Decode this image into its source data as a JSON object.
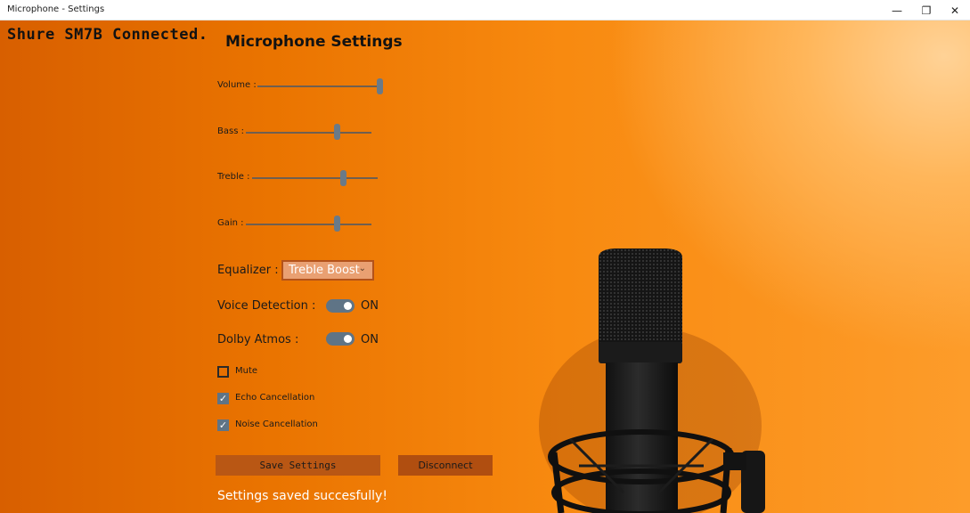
{
  "window": {
    "title": "Microphone - Settings",
    "minimize_icon": "—",
    "restore_icon": "❐",
    "close_icon": "✕"
  },
  "status": "Shure SM7B Connected.",
  "heading": "Microphone Settings",
  "sliders": [
    {
      "label": "Volume :",
      "value": 1.0
    },
    {
      "label": "Bass :",
      "value": 0.74
    },
    {
      "label": "Treble :",
      "value": 0.74
    },
    {
      "label": "Gain :",
      "value": 0.74
    }
  ],
  "equalizer": {
    "label": "Equalizer :",
    "value": "Treble Boost",
    "icon": "chevron-down-icon"
  },
  "toggles": [
    {
      "label": "Voice Detection :",
      "state_text": "ON",
      "on": true
    },
    {
      "label": "Dolby Atmos :",
      "state_text": "ON",
      "on": true
    }
  ],
  "checkboxes": [
    {
      "label": "Mute",
      "checked": false
    },
    {
      "label": "Echo Cancellation",
      "checked": true
    },
    {
      "label": "Noise Cancellation",
      "checked": true
    }
  ],
  "buttons": {
    "save": "Save Settings",
    "disconnect": "Disconnect"
  },
  "message": "Settings saved succesfully!",
  "colors": {
    "accent": "#5f7486",
    "background": "#f07e08",
    "button": "#b95714"
  }
}
